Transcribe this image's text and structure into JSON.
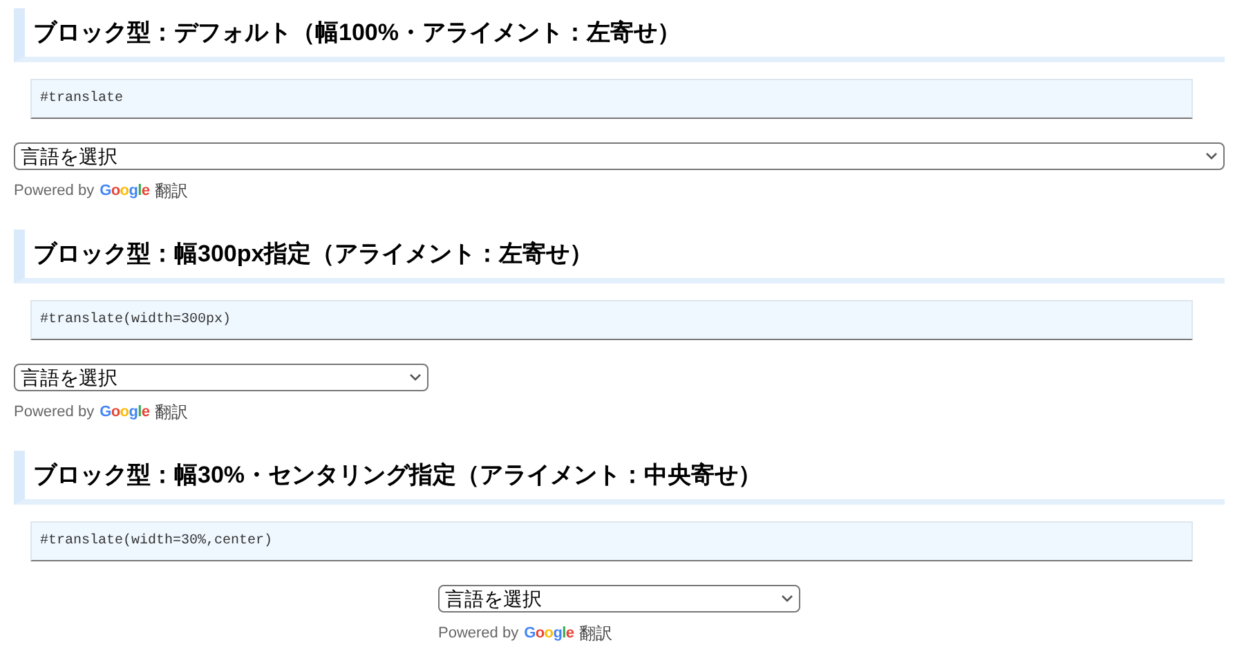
{
  "sections": [
    {
      "kind": "default",
      "title": "ブロック型：デフォルト（幅100%・アライメント：左寄せ）",
      "code": "#translate",
      "select": {
        "value": "言語を選択"
      },
      "powered_by": "Powered by",
      "brand": "Google",
      "service": "翻訳"
    },
    {
      "kind": "fixed",
      "title": "ブロック型：幅300px指定（アライメント：左寄せ）",
      "code": "#translate(width=300px)",
      "select": {
        "value": "言語を選択"
      },
      "powered_by": "Powered by",
      "brand": "Google",
      "service": "翻訳"
    },
    {
      "kind": "centered",
      "title": "ブロック型：幅30%・センタリング指定（アライメント：中央寄せ）",
      "code": "#translate(width=30%,center)",
      "select": {
        "value": "言語を選択"
      },
      "powered_by": "Powered by",
      "brand": "Google",
      "service": "翻訳"
    }
  ]
}
